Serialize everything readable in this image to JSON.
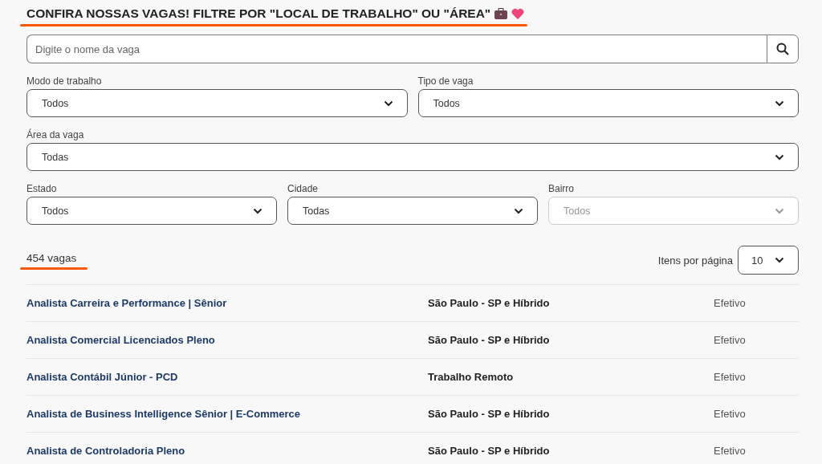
{
  "heading": "CONFIRA NOSSAS VAGAS! FILTRE POR \"LOCAL DE TRABALHO\" OU \"ÁREA\"",
  "search": {
    "placeholder": "Digite o nome da vaga"
  },
  "filter_rows": [
    [
      {
        "label": "Modo de trabalho",
        "value": "Todos",
        "disabled": false
      },
      {
        "label": "Tipo de vaga",
        "value": "Todos",
        "disabled": false
      }
    ],
    [
      {
        "label": "Área da vaga",
        "value": "Todas",
        "disabled": false
      }
    ],
    [
      {
        "label": "Estado",
        "value": "Todos",
        "disabled": false
      },
      {
        "label": "Cidade",
        "value": "Todas",
        "disabled": false
      },
      {
        "label": "Bairro",
        "value": "Todos",
        "disabled": true
      }
    ]
  ],
  "count": "454 vagas",
  "per_page": {
    "label": "Itens por página",
    "value": "10"
  },
  "jobs": [
    {
      "title": "Analista Carreira e Performance | Sênior",
      "location": "São Paulo - SP e Híbrido",
      "type": "Efetivo"
    },
    {
      "title": "Analista Comercial Licenciados Pleno",
      "location": "São Paulo - SP e Híbrido",
      "type": "Efetivo"
    },
    {
      "title": "Analista Contábil Júnior - PCD",
      "location": "Trabalho Remoto",
      "type": "Efetivo"
    },
    {
      "title": "Analista de Business Intelligence Sênior | E-Commerce",
      "location": "São Paulo - SP e Híbrido",
      "type": "Efetivo"
    },
    {
      "title": "Analista de Controladoria Pleno",
      "location": "São Paulo - SP e Híbrido",
      "type": "Efetivo"
    }
  ]
}
